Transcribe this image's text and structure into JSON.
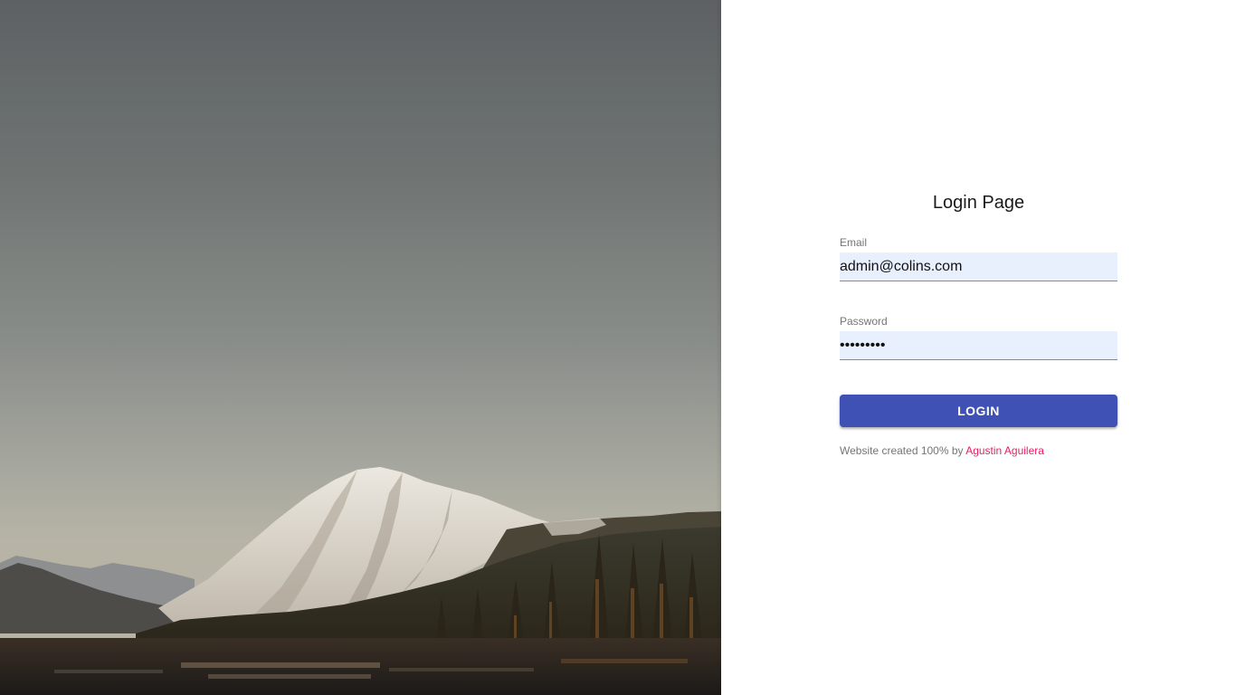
{
  "login": {
    "title": "Login Page",
    "email": {
      "label": "Email",
      "value": "admin@colins.com"
    },
    "password": {
      "label": "Password",
      "value": "•••••••••"
    },
    "submit_label": "LOGIN"
  },
  "footer": {
    "credit_text": "Website created 100% by",
    "author_name": "Agustin Aguilera"
  },
  "colors": {
    "accent": "#3f51b5",
    "link": "#e91e63",
    "autofill_bg": "#e8f0fe"
  },
  "hero_image": "mountain-lake-landscape"
}
